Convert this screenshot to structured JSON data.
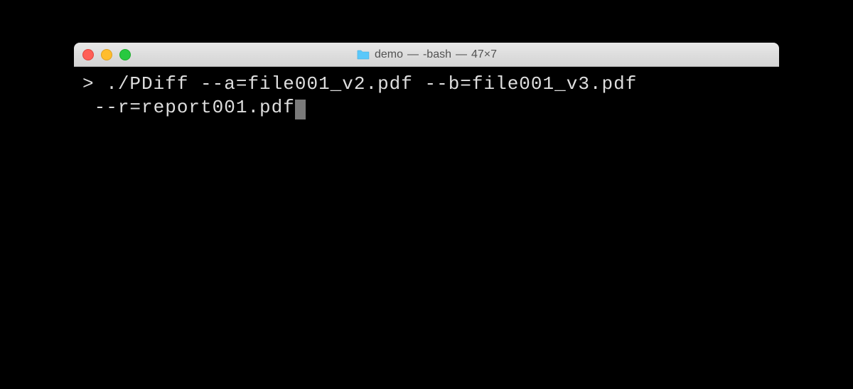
{
  "window": {
    "title_folder": "demo",
    "title_shell": "-bash",
    "title_dims": "47×7"
  },
  "terminal": {
    "prompt": "> ",
    "line1": "./PDiff --a=file001_v2.pdf --b=file001_v3.pdf",
    "line2": " --r=report001.pdf"
  }
}
